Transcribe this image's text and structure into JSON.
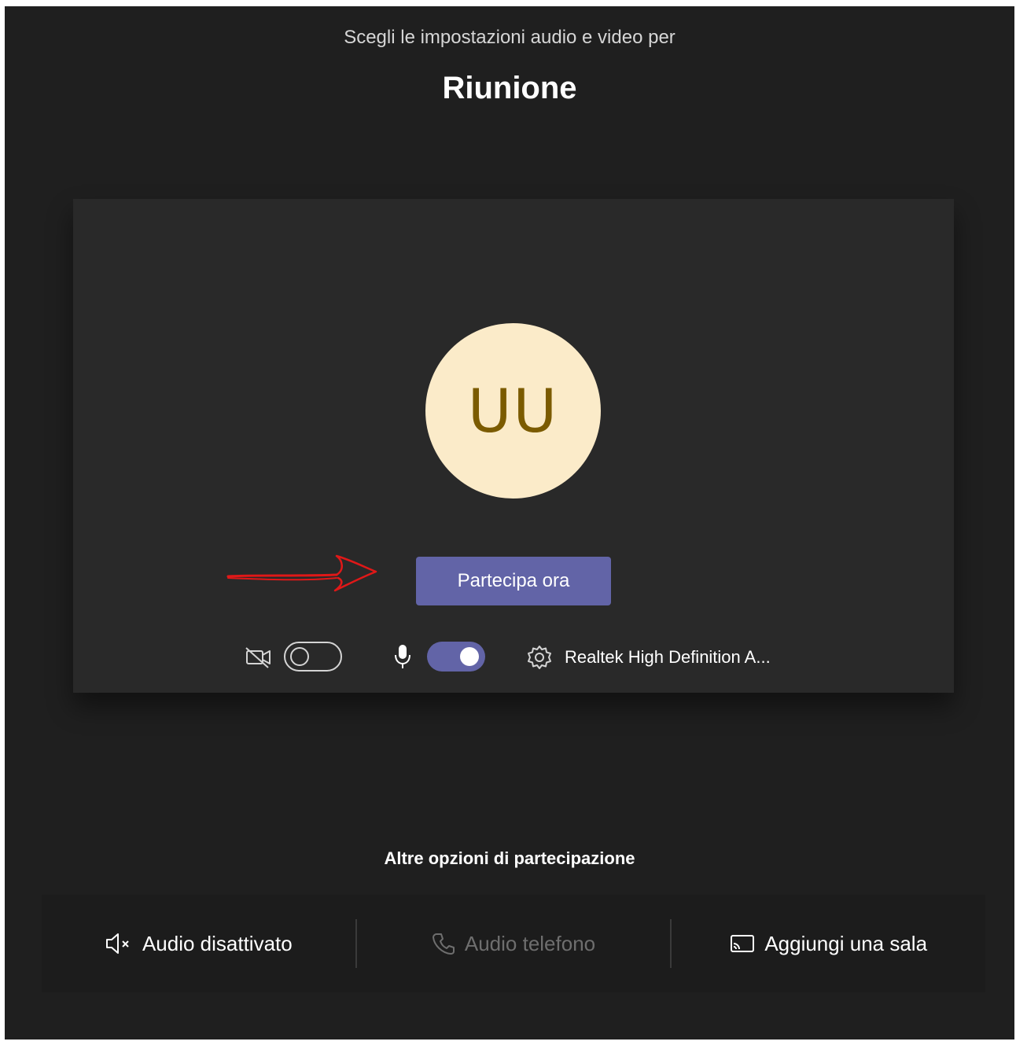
{
  "header": {
    "subtitle": "Scegli le impostazioni audio e video per",
    "title": "Riunione"
  },
  "preview": {
    "avatar_initials": "UU",
    "avatar_bg": "#fbebc9",
    "avatar_fg": "#7b5b00",
    "join_button_label": "Partecipa ora",
    "accent": "#6264a7"
  },
  "controls": {
    "camera_icon": "video-off-icon",
    "camera_on": false,
    "mic_icon": "microphone-icon",
    "mic_on": true,
    "settings_icon": "gear-icon",
    "device_label": "Realtek High Definition A..."
  },
  "other_options": {
    "heading": "Altre opzioni di partecipazione",
    "items": [
      {
        "icon": "speaker-muted-icon",
        "label": "Audio disattivato",
        "enabled": true
      },
      {
        "icon": "phone-icon",
        "label": "Audio telefono",
        "enabled": false
      },
      {
        "icon": "cast-icon",
        "label": "Aggiungi una sala",
        "enabled": true
      }
    ]
  }
}
